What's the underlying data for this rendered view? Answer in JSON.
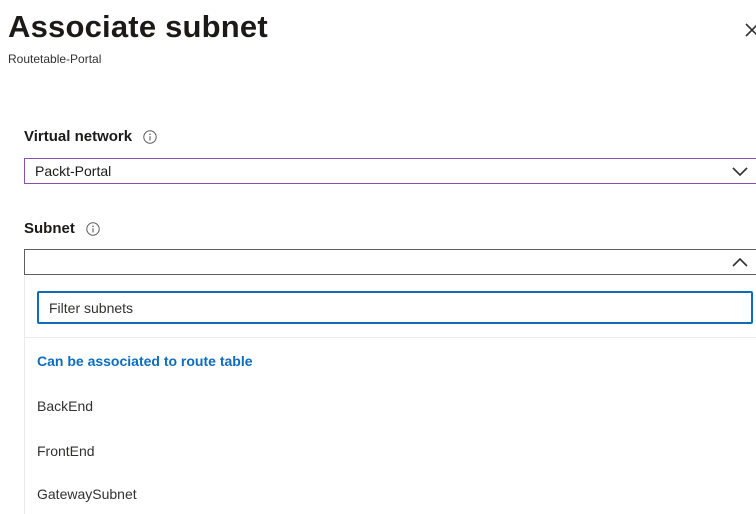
{
  "header": {
    "title": "Associate subnet",
    "subtitle": "Routetable-Portal",
    "close_icon": "close-icon"
  },
  "virtual_network": {
    "label": "Virtual network",
    "info_icon": "info-icon",
    "selected": "Packt-Portal",
    "expanded": false
  },
  "subnet": {
    "label": "Subnet",
    "info_icon": "info-icon",
    "selected": "",
    "expanded": true,
    "filter": {
      "value": "",
      "placeholder": "Filter subnets"
    },
    "group_header": "Can be associated to route table",
    "options": [
      {
        "label": "BackEnd"
      },
      {
        "label": "FrontEnd"
      },
      {
        "label": "GatewaySubnet"
      }
    ]
  },
  "colors": {
    "accent": "#0f6cbd",
    "focus_border": "#8a50b0",
    "text": "#323130"
  }
}
